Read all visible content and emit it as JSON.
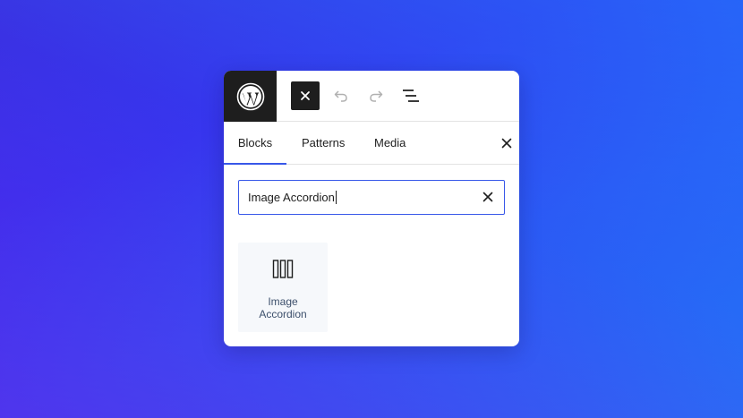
{
  "toolbar": {
    "logo_icon": "wordpress-logo",
    "close_icon": "close-icon",
    "undo_icon": "undo-icon",
    "redo_icon": "redo-icon",
    "list_view_icon": "list-view-icon"
  },
  "tabs": [
    {
      "label": "Blocks",
      "active": true
    },
    {
      "label": "Patterns",
      "active": false
    },
    {
      "label": "Media",
      "active": false
    }
  ],
  "search": {
    "value": "Image Accordion",
    "clear_icon": "close-icon"
  },
  "results": [
    {
      "icon": "image-accordion-icon",
      "label_line1": "Image",
      "label_line2": "Accordion"
    }
  ],
  "colors": {
    "accent": "#3858e9",
    "dark": "#1e1e1e",
    "block_label": "#3c4f6b"
  }
}
